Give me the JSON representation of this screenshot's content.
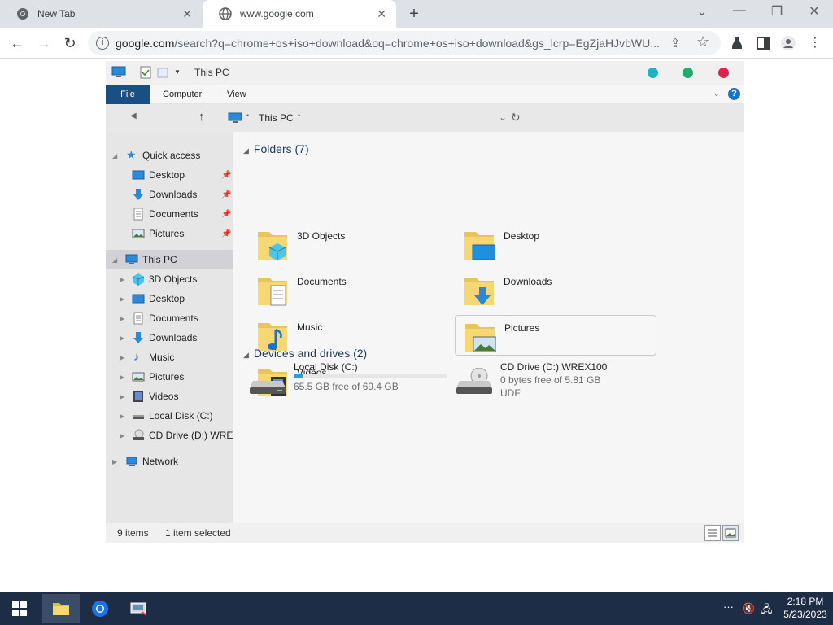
{
  "browser": {
    "tabs": [
      {
        "title": "New Tab",
        "icon": "chrome-icon"
      },
      {
        "title": "www.google.com",
        "icon": "globe-icon",
        "active": true
      }
    ],
    "address_host": "google.com",
    "address_rest": "/search?q=chrome+os+iso+download&oq=chrome+os+iso+download&gs_lcrp=EgZjaHJvbWU..."
  },
  "explorer": {
    "title": "This PC",
    "ribbon": {
      "file": "File",
      "tabs": [
        "Computer",
        "View"
      ]
    },
    "address": "This PC",
    "nav": {
      "quick_access": {
        "label": "Quick access",
        "items": [
          {
            "label": "Desktop",
            "icon": "desktop-icon"
          },
          {
            "label": "Downloads",
            "icon": "downloads-icon"
          },
          {
            "label": "Documents",
            "icon": "documents-icon"
          },
          {
            "label": "Pictures",
            "icon": "pictures-icon"
          }
        ]
      },
      "this_pc": {
        "label": "This PC",
        "items": [
          {
            "label": "3D Objects",
            "icon": "3d-objects-icon"
          },
          {
            "label": "Desktop",
            "icon": "desktop-icon"
          },
          {
            "label": "Documents",
            "icon": "documents-icon"
          },
          {
            "label": "Downloads",
            "icon": "downloads-icon"
          },
          {
            "label": "Music",
            "icon": "music-icon"
          },
          {
            "label": "Pictures",
            "icon": "pictures-icon"
          },
          {
            "label": "Videos",
            "icon": "videos-icon"
          },
          {
            "label": "Local Disk (C:)",
            "icon": "local-disk-icon"
          },
          {
            "label": "CD Drive (D:) WREX100",
            "icon": "cd-drive-icon"
          }
        ]
      },
      "network": {
        "label": "Network",
        "icon": "network-icon"
      }
    },
    "folders_header": "Folders (7)",
    "folders": [
      {
        "label": "3D Objects",
        "icon": "3d-objects-icon"
      },
      {
        "label": "Desktop",
        "icon": "desktop-icon"
      },
      {
        "label": "Documents",
        "icon": "documents-icon"
      },
      {
        "label": "Downloads",
        "icon": "downloads-icon"
      },
      {
        "label": "Music",
        "icon": "music-icon"
      },
      {
        "label": "Pictures",
        "icon": "pictures-icon",
        "selected": true
      },
      {
        "label": "Videos",
        "icon": "videos-icon"
      }
    ],
    "drives_header": "Devices and drives (2)",
    "drives": [
      {
        "name": "Local Disk (C:)",
        "free_text": "65.5 GB free of 69.4 GB",
        "used_fraction": 0.056,
        "icon": "local-disk-icon"
      },
      {
        "name": "CD Drive (D:) WREX100",
        "free_text": "0 bytes free of 5.81 GB",
        "fs": "UDF",
        "icon": "cd-drive-icon"
      }
    ],
    "status": {
      "items": "9 items",
      "selected": "1 item selected"
    }
  },
  "taskbar": {
    "apps": [
      "file-explorer-icon",
      "chrome-icon",
      "network-manager-icon"
    ],
    "time": "2:18 PM",
    "date": "5/23/2023"
  },
  "colors": {
    "file_tab": "#1a4f84",
    "dot_teal": "#1ab3c4",
    "dot_green": "#1fae6a",
    "dot_red": "#e0204f",
    "taskbar": "#1c2d45",
    "drive_bar": "#26a0da"
  }
}
